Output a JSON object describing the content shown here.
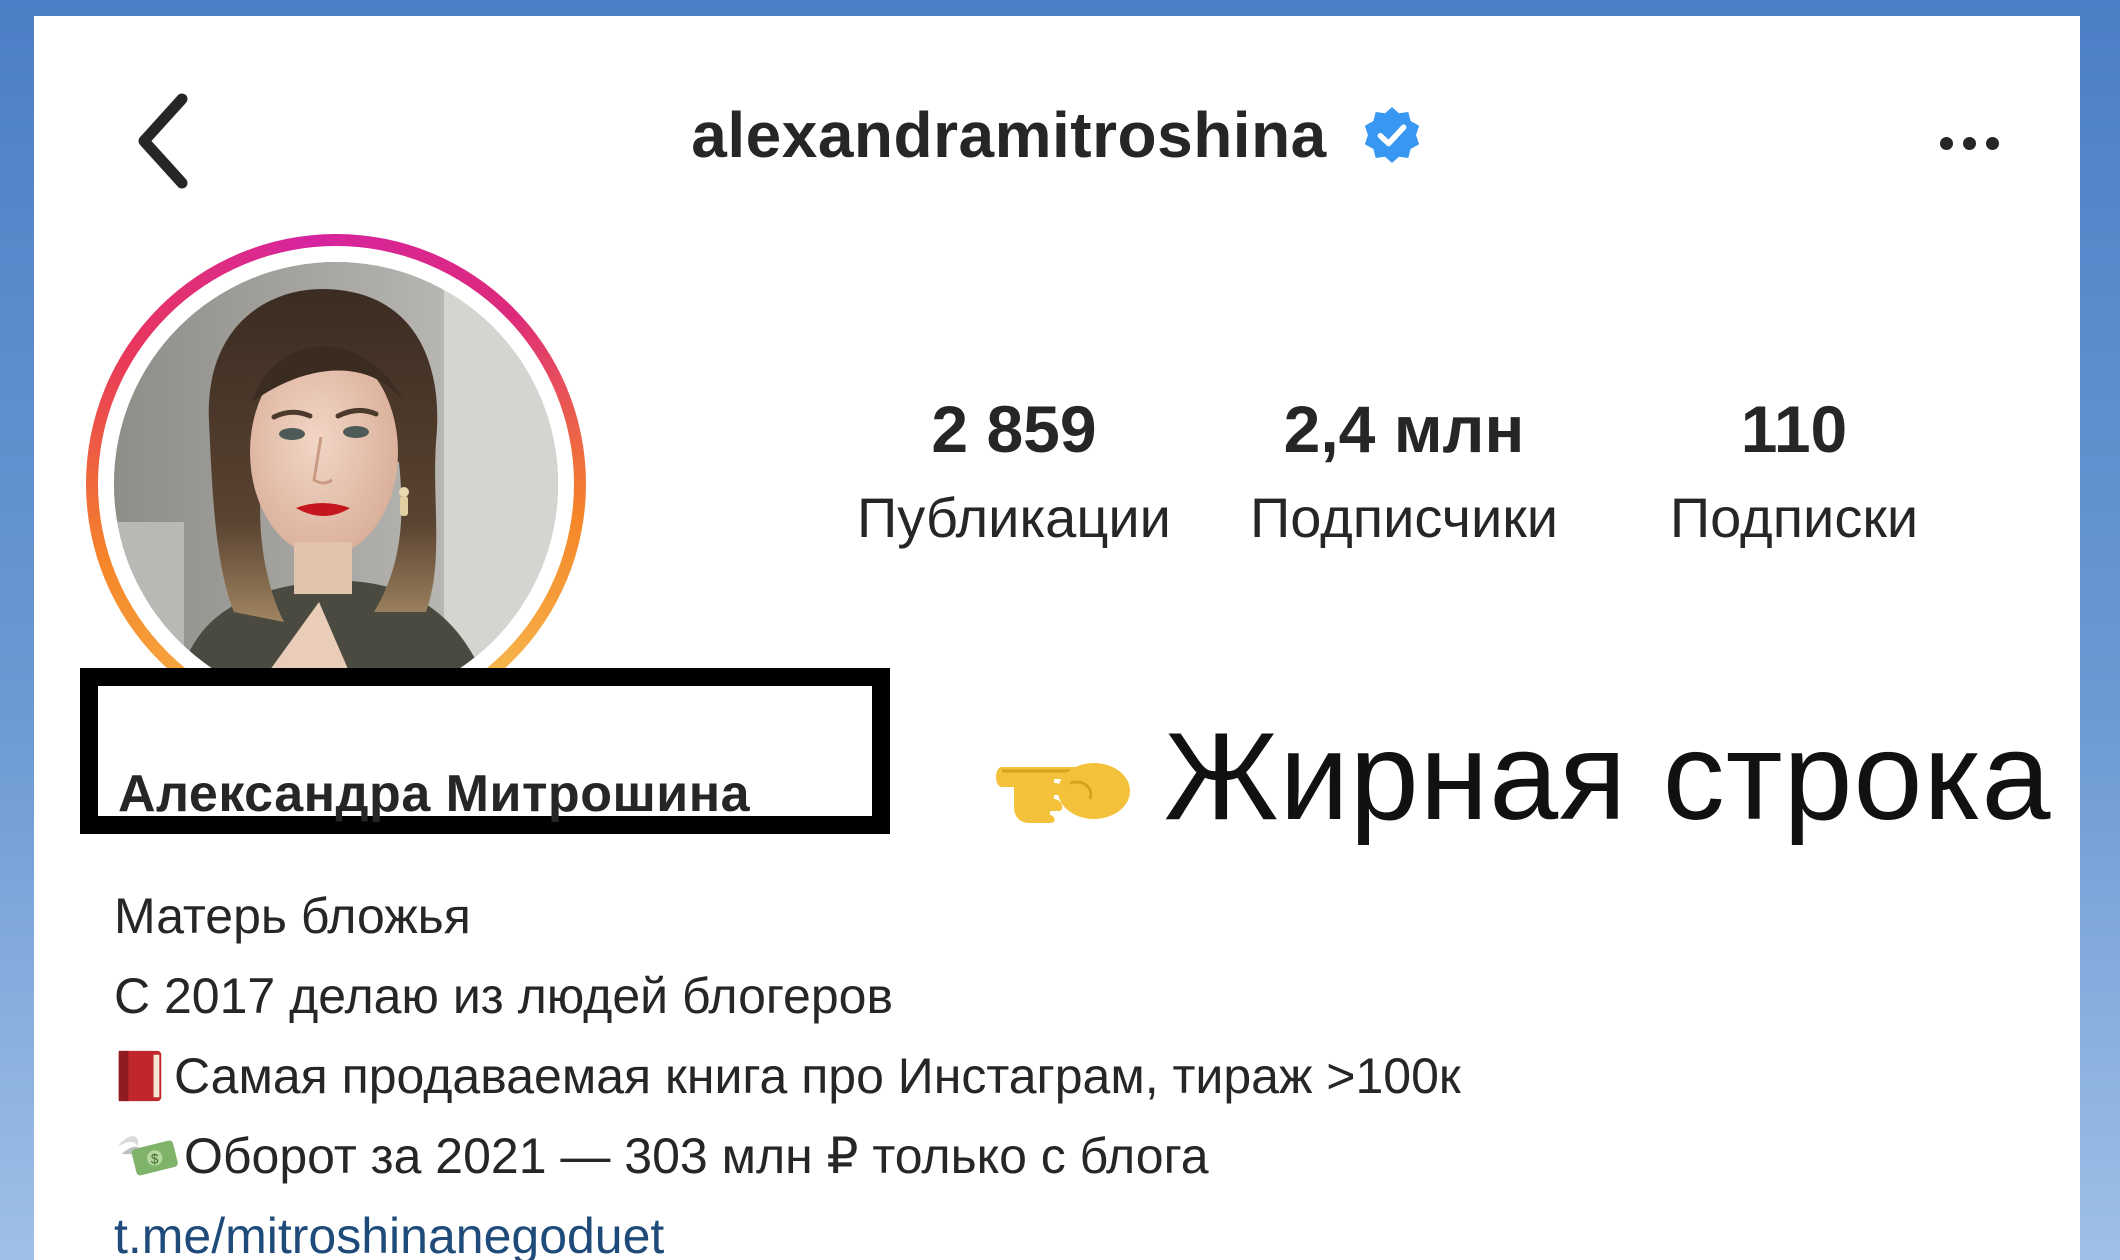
{
  "header": {
    "username": "alexandramitroshina",
    "verified_icon": "verified-badge-icon",
    "back_icon": "chevron-left-icon",
    "more_icon": "more-horizontal-icon"
  },
  "profile": {
    "avatar_alt": "profile-photo",
    "name": "Александра Митрошина"
  },
  "stats": [
    {
      "value": "2 859",
      "label": "Публикации"
    },
    {
      "value": "2,4 млн",
      "label": "Подписчики"
    },
    {
      "value": "110",
      "label": "Подписки"
    }
  ],
  "bio": {
    "category": "Матерь бложья",
    "line1": "С 2017 делаю из людей блогеров",
    "line2_emoji": "closed-book-icon",
    "line2": "Самая продаваемая книга про Инстаграм, тираж >100к",
    "line3_emoji": "money-with-wings-icon",
    "line3": "Оборот за 2021 — 303 млн ₽ только с блога",
    "link": "t.me/mitroshinanegoduet"
  },
  "annotation": {
    "pointer_icon": "pointing-hand-icon",
    "text": "Жирная строка"
  },
  "colors": {
    "background": "#4d7fc6",
    "verified": "#3897f0",
    "link": "#1f4b7a",
    "ring_start": "#f58529",
    "ring_end": "#dd2a7b"
  }
}
